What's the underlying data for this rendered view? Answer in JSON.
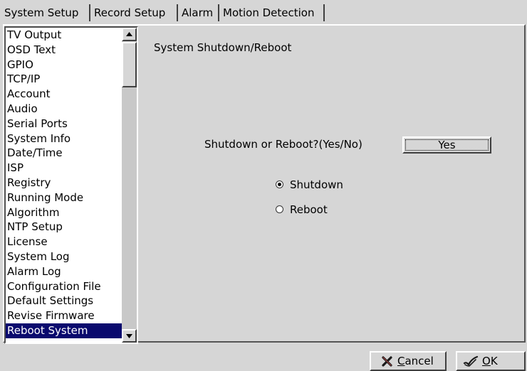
{
  "tabs": [
    {
      "label": "System Setup",
      "active": true
    },
    {
      "label": "Record Setup",
      "active": false
    },
    {
      "label": "Alarm",
      "active": false
    },
    {
      "label": "Motion Detection",
      "active": false
    }
  ],
  "sidebar": {
    "items": [
      {
        "label": "TV Output"
      },
      {
        "label": "OSD Text"
      },
      {
        "label": "GPIO"
      },
      {
        "label": "TCP/IP"
      },
      {
        "label": "Account"
      },
      {
        "label": "Audio"
      },
      {
        "label": "Serial Ports"
      },
      {
        "label": "System Info"
      },
      {
        "label": "Date/Time"
      },
      {
        "label": "ISP"
      },
      {
        "label": "Registry"
      },
      {
        "label": "Running Mode"
      },
      {
        "label": "Algorithm"
      },
      {
        "label": "NTP Setup"
      },
      {
        "label": "License"
      },
      {
        "label": "System Log"
      },
      {
        "label": "Alarm Log"
      },
      {
        "label": "Configuration File"
      },
      {
        "label": "Default Settings"
      },
      {
        "label": "Revise Firmware"
      },
      {
        "label": "Reboot System",
        "selected": true
      }
    ]
  },
  "panel": {
    "title": "System Shutdown/Reboot",
    "question": "Shutdown or Reboot?(Yes/No)",
    "yes_label": "Yes",
    "options": [
      {
        "label": "Shutdown",
        "checked": true
      },
      {
        "label": "Reboot",
        "checked": false
      }
    ]
  },
  "footer": {
    "cancel": {
      "mnemonic": "C",
      "rest": "ancel",
      "icon": "x-cross-icon"
    },
    "ok": {
      "mnemonic": "O",
      "rest": "K",
      "icon": "checkmark-icon"
    }
  },
  "colors": {
    "selection": "#0a0a6e",
    "background": "#d6d6d6"
  }
}
